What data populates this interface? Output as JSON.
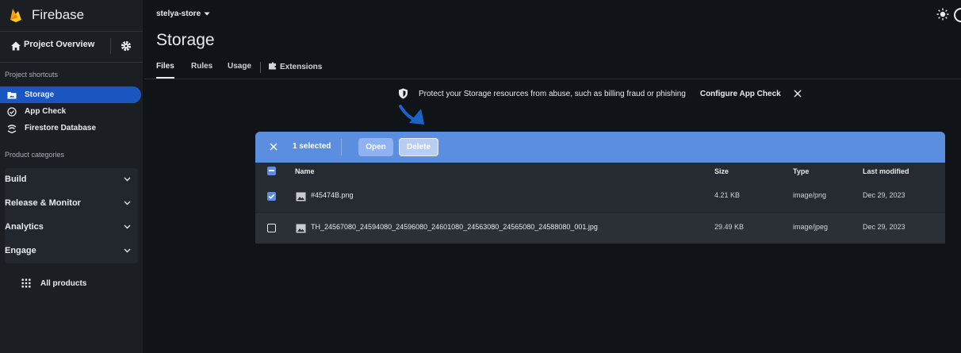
{
  "app": {
    "brand_name": "Firebase"
  },
  "sidebar": {
    "project_overview": "Project Overview",
    "shortcuts_label": "Project shortcuts",
    "shortcuts": [
      {
        "label": "Storage",
        "icon": "folder-icon",
        "active": true
      },
      {
        "label": "App Check",
        "icon": "app-check-icon",
        "active": false
      },
      {
        "label": "Firestore Database",
        "icon": "firestore-icon",
        "active": false
      }
    ],
    "categories_label": "Product categories",
    "categories": [
      "Build",
      "Release & Monitor",
      "Analytics",
      "Engage"
    ],
    "all_products": "All products"
  },
  "header": {
    "project": "stelya-store"
  },
  "page": {
    "title": "Storage",
    "tabs": [
      "Files",
      "Rules",
      "Usage",
      "Extensions"
    ],
    "active_tab": "Files"
  },
  "banner": {
    "message": "Protect your Storage resources from abuse, such as billing fraud or phishing",
    "cta": "Configure App Check"
  },
  "selection": {
    "count_label": "1 selected",
    "open_label": "Open",
    "delete_label": "Delete"
  },
  "table": {
    "columns": [
      "Name",
      "Size",
      "Type",
      "Last modified"
    ],
    "rows": [
      {
        "name": "#45474B.png",
        "size": "4.21 KB",
        "type": "image/png",
        "modified": "Dec 29, 2023",
        "checked": true
      },
      {
        "name": "TH_24567080_24594080_24596080_24601080_24563080_24565080_24588080_001.jpg",
        "size": "29.49 KB",
        "type": "image/jpeg",
        "modified": "Dec 29, 2023",
        "checked": false
      }
    ]
  },
  "colors": {
    "accent_blue": "#1a56c0",
    "selection_bar": "#5c8ee0",
    "background": "#101419",
    "sidebar": "#1b1f24",
    "firebase_yellow": "#ffca28"
  }
}
